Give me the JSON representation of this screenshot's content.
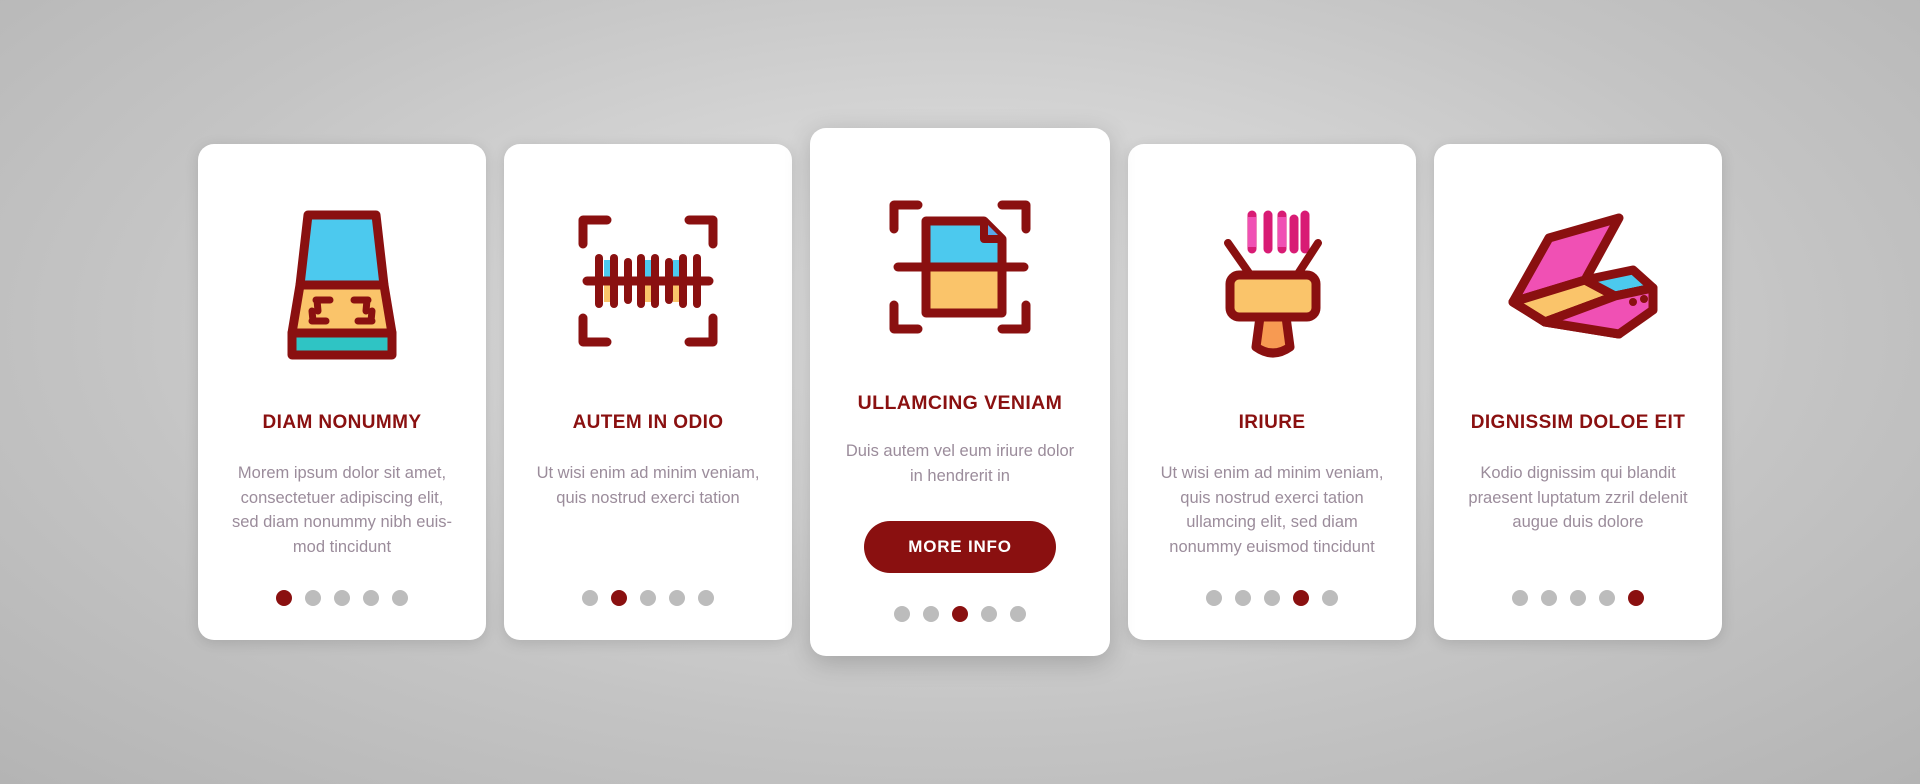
{
  "theme": {
    "accent": "#8a1010",
    "body_text": "#9b8c9b",
    "dot_inactive": "#bcbcbc",
    "card_bg": "#ffffff",
    "page_bg": "#c8c8c8",
    "icon_outline": "#8a1010",
    "icon_blue": "#4cc9ee",
    "icon_teal": "#2fc4c4",
    "icon_orange": "#fac46a",
    "icon_orange_deep": "#f79a52",
    "icon_pink": "#f050b4",
    "icon_magenta": "#d81b74"
  },
  "cards": [
    {
      "id": "card-1",
      "icon": "flatbed-scanner-open-icon",
      "title": "DIAM NONUMMY",
      "body": "Morem ipsum dolor sit amet, consectetuer adipiscing elit, sed diam nonummy nibh euis-mod tincidunt",
      "featured": false,
      "dots": {
        "count": 5,
        "active_index": 0
      }
    },
    {
      "id": "card-2",
      "icon": "barcode-scan-frame-icon",
      "title": "AUTEM IN ODIO",
      "body": "Ut wisi enim ad minim veniam, quis nostrud exerci tation",
      "featured": false,
      "dots": {
        "count": 5,
        "active_index": 1
      }
    },
    {
      "id": "card-3",
      "icon": "document-scan-frame-icon",
      "title": "ULLAMCING VENIAM",
      "body": "Duis autem vel eum iriure dolor in hendrerit in",
      "featured": true,
      "button_label": "MORE INFO",
      "dots": {
        "count": 5,
        "active_index": 2
      }
    },
    {
      "id": "card-4",
      "icon": "handheld-barcode-scanner-icon",
      "title": "IRIURE",
      "body": "Ut wisi enim ad minim veniam, quis nostrud exerci tation ullamcing elit, sed diam nonummy euismod tincidunt",
      "featured": false,
      "dots": {
        "count": 5,
        "active_index": 3
      }
    },
    {
      "id": "card-5",
      "icon": "isometric-scanner-open-icon",
      "title": "DIGNISSIM DOLOE EIT",
      "body": "Kodio dignissim qui blandit praesent luptatum zzril delenit augue duis dolore",
      "featured": false,
      "dots": {
        "count": 5,
        "active_index": 4
      }
    }
  ]
}
